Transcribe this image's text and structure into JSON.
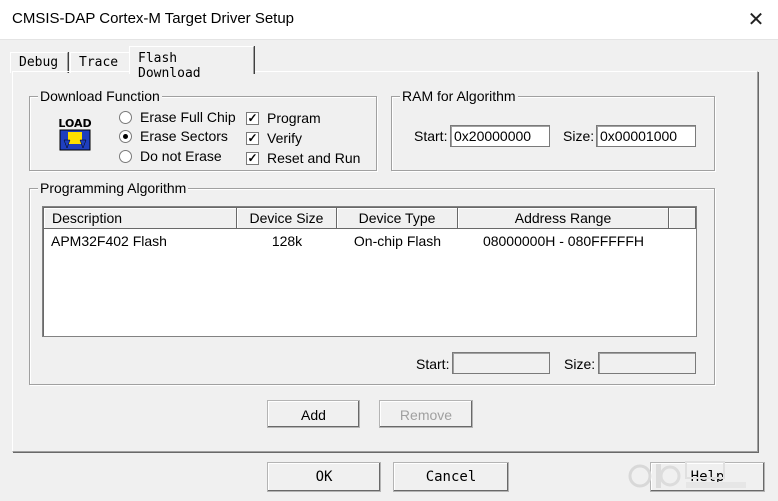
{
  "window": {
    "title": "CMSIS-DAP Cortex-M Target Driver Setup"
  },
  "tabs": [
    {
      "label": "Debug",
      "active": false
    },
    {
      "label": "Trace",
      "active": false
    },
    {
      "label": "Flash Download",
      "active": true
    }
  ],
  "download_function": {
    "legend": "Download Function",
    "icon_text": "LOAD",
    "radios": [
      {
        "label": "Erase Full Chip",
        "selected": false
      },
      {
        "label": "Erase Sectors",
        "selected": true
      },
      {
        "label": "Do not Erase",
        "selected": false
      }
    ],
    "checks": [
      {
        "label": "Program",
        "checked": true
      },
      {
        "label": "Verify",
        "checked": true
      },
      {
        "label": "Reset and Run",
        "checked": true
      }
    ]
  },
  "ram": {
    "legend": "RAM for Algorithm",
    "start_label": "Start:",
    "start_value": "0x20000000",
    "size_label": "Size:",
    "size_value": "0x00001000"
  },
  "programming_algorithm": {
    "legend": "Programming Algorithm",
    "columns": [
      "Description",
      "Device Size",
      "Device Type",
      "Address Range"
    ],
    "rows": [
      [
        "APM32F402 Flash",
        "128k",
        "On-chip Flash",
        "08000000H - 080FFFFFH"
      ]
    ],
    "start_label": "Start:",
    "start_value": "",
    "size_label": "Size:",
    "size_value": ""
  },
  "buttons": {
    "add": "Add",
    "remove": "Remove",
    "ok": "OK",
    "cancel": "Cancel",
    "help": "Help"
  },
  "colors": {
    "icon_blue": "#1f3fbf",
    "icon_yellow": "#ffe000"
  }
}
